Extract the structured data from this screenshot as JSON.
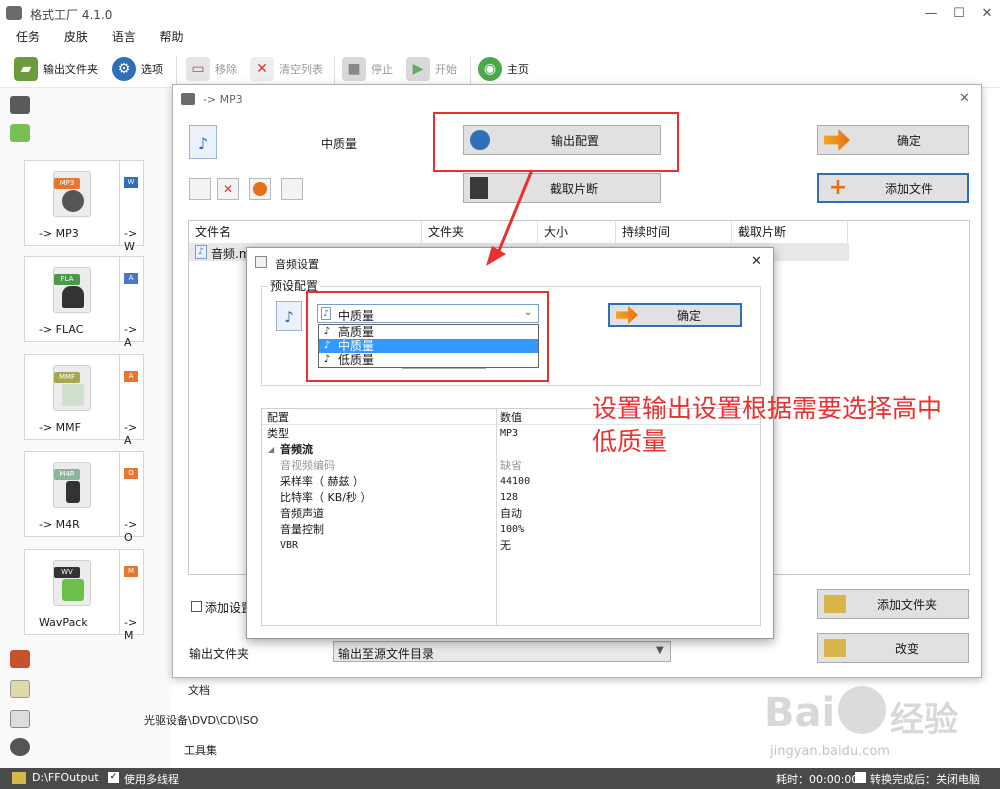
{
  "window": {
    "title": "格式工厂 4.1.0"
  },
  "menu": [
    "任务",
    "皮肤",
    "语言",
    "帮助"
  ],
  "toolbar": {
    "output_folder": "输出文件夹",
    "options": "选项",
    "remove": "移除",
    "clear_list": "清空列表",
    "stop": "停止",
    "start": "开始",
    "home": "主页"
  },
  "tiles": [
    {
      "label": "-> MP3",
      "badge": "MP3",
      "badge_color": "#e7772d"
    },
    {
      "label": "-> FLAC",
      "badge": "FLA",
      "badge_color": "#4a9a4a"
    },
    {
      "label": "-> MMF",
      "badge": "MMF",
      "badge_color": "#a8a64e"
    },
    {
      "label": "-> M4R",
      "badge": "M4R",
      "badge_color": "#8db39a"
    },
    {
      "label": "WavPack",
      "badge": "WV",
      "badge_color": "#333333"
    }
  ],
  "tiles_col2": [
    "-> W",
    "-> A",
    "-> A",
    "-> O",
    "-> M"
  ],
  "tiles_col2_badges": [
    "W",
    "A",
    "A",
    "O",
    "M"
  ],
  "categories": {
    "doc": "文档",
    "optical": "光驱设备\\DVD\\CD\\ISO",
    "tools": "工具集"
  },
  "mp3_dialog": {
    "title": "-> MP3",
    "quality": "中质量",
    "output_config_button": "输出配置",
    "ok_button": "确定",
    "clip_button": "截取片断",
    "add_file_button": "添加文件",
    "columns": [
      "文件名",
      "文件夹",
      "大小",
      "持续时间",
      "截取片断"
    ],
    "file_row_name": "音频.m",
    "add_settings_checkbox": "添加设置",
    "add_folder_button": "添加文件夹",
    "output_folder_label": "输出文件夹",
    "output_folder_value": "输出至源文件目录",
    "change_button": "改变"
  },
  "audio_dialog": {
    "title": "音频设置",
    "preset_group": "预设配置",
    "selected": "中质量",
    "options": [
      "高质量",
      "中质量",
      "低质量"
    ],
    "ok_button": "确定",
    "prop_header": {
      "key": "配置",
      "value": "数值"
    },
    "props": [
      {
        "k": "类型",
        "v": "MP3"
      },
      {
        "k": "音频流",
        "v": "",
        "group": true
      },
      {
        "k": "音视频编码",
        "v": "缺省",
        "dim": true
      },
      {
        "k": "采样率（ 赫兹 ）",
        "v": "44100"
      },
      {
        "k": "比特率（ KB/秒 ）",
        "v": "128"
      },
      {
        "k": "音频声道",
        "v": "自动"
      },
      {
        "k": "音量控制",
        "v": "100%"
      },
      {
        "k": "VBR",
        "v": "无"
      }
    ]
  },
  "annotation": "设置输出设置根据需要选择高中低质量",
  "status": {
    "output_path": "D:\\FFOutput",
    "multithread": "使用多线程",
    "elapsed": "耗时：00:00:00",
    "after_convert": "转换完成后：关闭电脑"
  },
  "watermark": {
    "brand": "Bai",
    "brand2": "经验",
    "url": "jingyan.baidu.com"
  },
  "colors": {
    "annotation_red": "#e8312f",
    "selection_blue": "#3399ff",
    "statusbar": "#4a4a4a"
  }
}
